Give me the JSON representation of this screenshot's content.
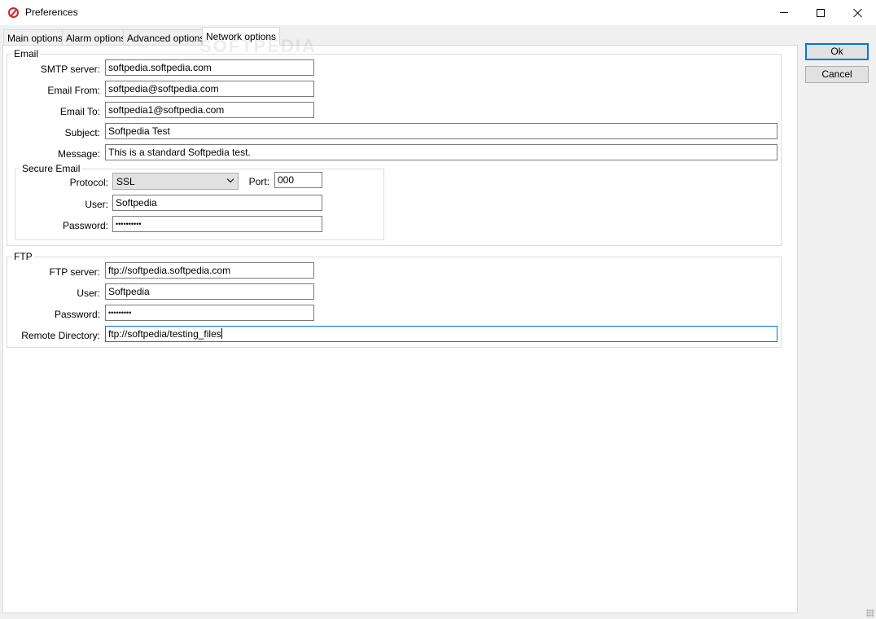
{
  "window": {
    "title": "Preferences",
    "watermark": "SOFTPEDIA"
  },
  "tabs": [
    {
      "label": "Main options"
    },
    {
      "label": "Alarm options"
    },
    {
      "label": "Advanced options"
    },
    {
      "label": "Network options",
      "active": true
    }
  ],
  "email": {
    "legend": "Email",
    "smtp_label": "SMTP server:",
    "smtp_value": "softpedia.softpedia.com",
    "from_label": "Email From:",
    "from_value": "softpedia@softpedia.com",
    "to_label": "Email To:",
    "to_value": "softpedia1@softpedia.com",
    "subject_label": "Subject:",
    "subject_value": "Softpedia Test",
    "message_label": "Message:",
    "message_value": "This is a standard Softpedia test.",
    "secure": {
      "legend": "Secure Email",
      "protocol_label": "Protocol:",
      "protocol_value": "SSL",
      "port_label": "Port:",
      "port_value": "000",
      "user_label": "User:",
      "user_value": "Softpedia",
      "password_label": "Password:",
      "password_value": "••••••••••"
    }
  },
  "ftp": {
    "legend": "FTP",
    "server_label": "FTP server:",
    "server_value": "ftp://softpedia.softpedia.com",
    "user_label": "User:",
    "user_value": "Softpedia",
    "password_label": "Password:",
    "password_value": "•••••••••",
    "remote_label": "Remote Directory:",
    "remote_value": "ftp://softpedia/testing_files"
  },
  "buttons": {
    "ok": "Ok",
    "cancel": "Cancel"
  }
}
